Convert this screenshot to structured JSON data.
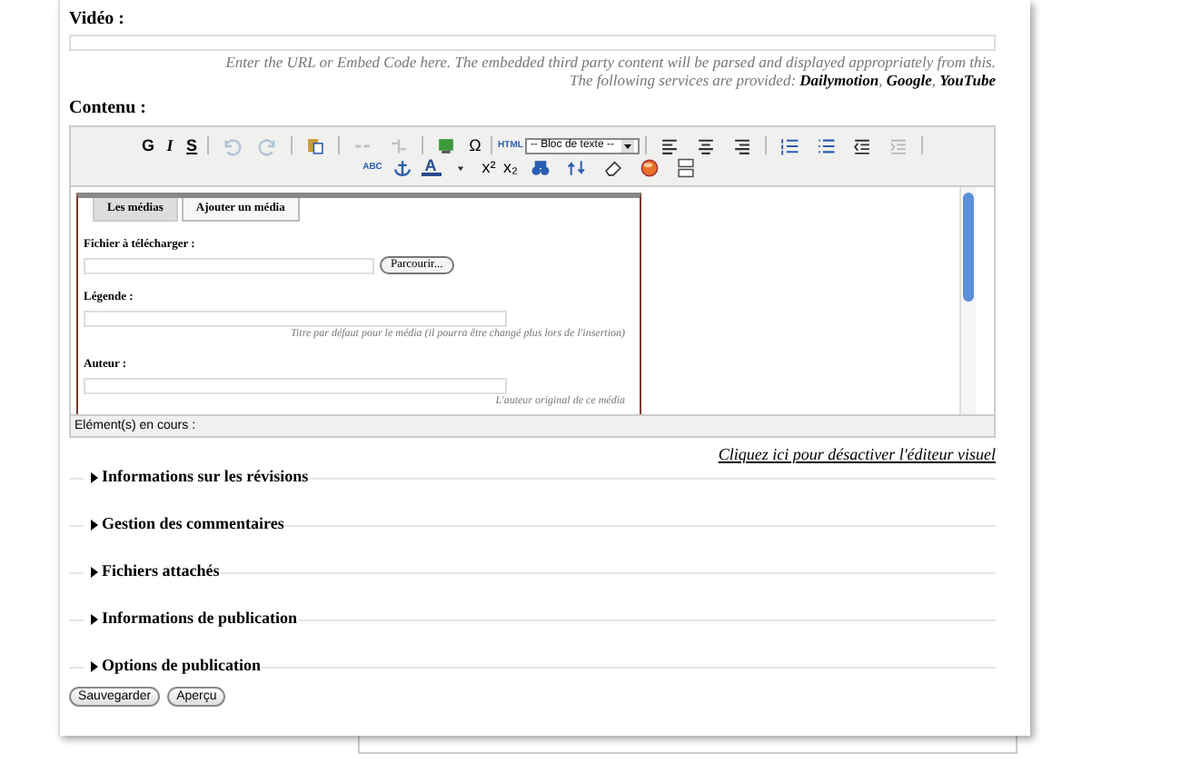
{
  "video": {
    "label": "Vidéo :",
    "help": "Enter the URL or Embed Code here. The embedded third party content will be parsed and displayed appropriately from this.",
    "help2": "The following services are provided: **Dailymotion**, **Google**, **YouTube**"
  },
  "content": {
    "label": "Contenu :"
  },
  "toolbar_rows": [
    [
      {
        "kind": "text",
        "label": "G",
        "disabled": false
      },
      {
        "kind": "text",
        "label": "I",
        "disabled": false
      },
      {
        "kind": "text",
        "label": "S",
        "disabled": false
      },
      {
        "kind": "sep"
      },
      {
        "kind": "icon",
        "disabled": true
      },
      {
        "kind": "icon",
        "disabled": true
      },
      {
        "kind": "sep"
      },
      {
        "kind": "icon",
        "disabled": false
      },
      {
        "kind": "sep"
      },
      {
        "kind": "icon",
        "disabled": true
      },
      {
        "kind": "icon",
        "disabled": true
      },
      {
        "kind": "sep"
      },
      {
        "kind": "icon",
        "disabled": false
      },
      {
        "kind": "text",
        "label": "Ω",
        "disabled": false
      },
      {
        "kind": "sep"
      },
      {
        "kind": "text",
        "label": "HTML",
        "disabled": false
      },
      {
        "kind": "select",
        "label": "-- Bloc de texte --"
      },
      {
        "kind": "sep"
      },
      {
        "kind": "icon",
        "disabled": false
      },
      {
        "kind": "icon",
        "disabled": false
      },
      {
        "kind": "icon",
        "disabled": false
      },
      {
        "kind": "sep"
      },
      {
        "kind": "icon",
        "disabled": false
      },
      {
        "kind": "icon",
        "disabled": false
      },
      {
        "kind": "icon",
        "disabled": false
      },
      {
        "kind": "icon",
        "disabled": true
      },
      {
        "kind": "sep"
      }
    ],
    [
      {
        "kind": "text",
        "label": "ABC",
        "disabled": false
      },
      {
        "kind": "icon",
        "disabled": false
      },
      {
        "kind": "text",
        "label": "A",
        "disabled": false
      },
      {
        "kind": "icon",
        "disabled": false
      },
      {
        "kind": "text",
        "label": "x²",
        "disabled": false
      },
      {
        "kind": "text",
        "label": "x₂",
        "disabled": false
      },
      {
        "kind": "icon",
        "disabled": false
      },
      {
        "kind": "icon",
        "disabled": false
      },
      {
        "kind": "icon",
        "disabled": false
      },
      {
        "kind": "icon",
        "disabled": false
      },
      {
        "kind": "icon",
        "disabled": false
      }
    ]
  ],
  "media_dialog": {
    "tabs": [
      {
        "label": "Les médias",
        "selected": false
      },
      {
        "label": "Ajouter un média",
        "selected": true
      }
    ],
    "fields": [
      {
        "label": "Fichier à télécharger :",
        "kind": "file",
        "button": "Parcourir..."
      },
      {
        "label": "Légende :",
        "kind": "text",
        "help": "Titre par défaut pour le média (il pourra être changé plus lors de l'insertion)"
      },
      {
        "label": "Auteur :",
        "kind": "text",
        "help": "L'auteur original de ce média"
      }
    ]
  },
  "status_bar": "Elément(s) en cours :",
  "toggle_link": "Cliquez ici pour désactiver l'éditeur visuel",
  "sections": [
    {
      "title": "Informations sur les révisions",
      "expanded": false
    },
    {
      "title": "Gestion des commentaires",
      "expanded": false
    },
    {
      "title": "Fichiers attachés",
      "expanded": false
    },
    {
      "title": "Informations de publication",
      "expanded": false
    },
    {
      "title": "Options de publication",
      "expanded": false
    }
  ],
  "buttons": [
    "Sauvegarder",
    "Aperçu"
  ]
}
